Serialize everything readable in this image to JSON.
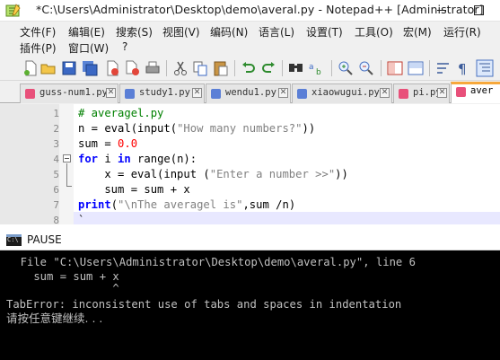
{
  "window": {
    "title": "*C:\\Users\\Administrator\\Desktop\\demo\\averal.py - Notepad++ [Administrator]"
  },
  "menu": {
    "row1": [
      "文件(F)",
      "编辑(E)",
      "搜索(S)",
      "视图(V)",
      "编码(N)",
      "语言(L)",
      "设置(T)",
      "工具(O)",
      "宏(M)",
      "运行(R)"
    ],
    "row2": [
      "插件(P)",
      "窗口(W)",
      "?"
    ]
  },
  "toolbar": {
    "buttons": [
      "new-file-icon",
      "open-file-icon",
      "save-icon",
      "save-all-icon",
      "close-icon",
      "close-all-icon",
      "print-icon",
      "cut-icon",
      "copy-icon",
      "paste-icon",
      "undo-icon",
      "redo-icon",
      "find-icon",
      "replace-icon",
      "zoom-in-icon",
      "zoom-out-icon",
      "sync-vertical-icon",
      "sync-horizontal-icon",
      "word-wrap-icon",
      "show-all-chars-icon",
      "indent-guide-icon"
    ]
  },
  "tabs": [
    {
      "label": "guss-num1.py",
      "color": "#e8507a",
      "active": false
    },
    {
      "label": "study1.py",
      "color": "#5b7fd6",
      "active": false
    },
    {
      "label": "wendu1.py",
      "color": "#5b7fd6",
      "active": false
    },
    {
      "label": "xiaowugui.py",
      "color": "#5b7fd6",
      "active": false
    },
    {
      "label": "pi.py",
      "color": "#e8507a",
      "active": false
    },
    {
      "label": "aver",
      "color": "#e8507a",
      "active": true
    }
  ],
  "editor": {
    "line_numbers": [
      "1",
      "2",
      "3",
      "4",
      "5",
      "6",
      "7",
      "8"
    ],
    "code": {
      "l1_comment": "# averagel.py",
      "l2_a": "n = eval(input(",
      "l2_str": "\"How many numbers?\"",
      "l2_b": "))",
      "l3_a": "sum = ",
      "l3_num": "0.0",
      "l4_kw1": "for",
      "l4_a": " i ",
      "l4_kw2": "in",
      "l4_b": " range(n):",
      "l5_a": "    x = eval(input (",
      "l5_str": "\"Enter a number >>\"",
      "l5_b": "))",
      "l6_a": "    sum = sum + x",
      "l7_kw": "print",
      "l7_a": "(",
      "l7_str": "\"\\nThe averagel is\"",
      "l7_b": ",sum /n)",
      "l8_a": "`"
    }
  },
  "console": {
    "title": "PAUSE",
    "lines": [
      "  File \"C:\\Users\\Administrator\\Desktop\\demo\\averal.py\", line 6",
      "    sum = sum + x",
      "                ^",
      "TabError: inconsistent use of tabs and spaces in indentation",
      "请按任意键继续. . ."
    ]
  }
}
